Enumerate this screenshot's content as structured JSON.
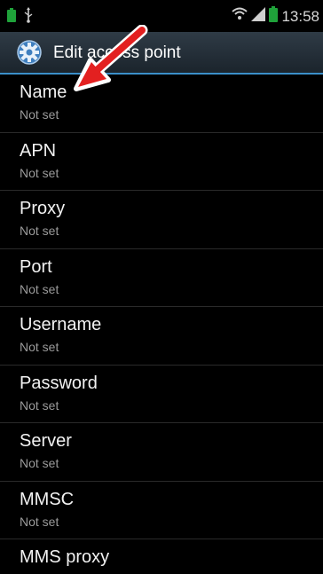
{
  "status_bar": {
    "time": "13:58",
    "icons": [
      "battery-small-icon",
      "usb-icon",
      "wifi-icon",
      "signal-icon",
      "battery-icon"
    ],
    "accent_color": "#1fa23a"
  },
  "action_bar": {
    "title": "Edit access point",
    "icon": "settings-gear-icon"
  },
  "list": {
    "items": [
      {
        "title": "Name",
        "summary": "Not set"
      },
      {
        "title": "APN",
        "summary": "Not set"
      },
      {
        "title": "Proxy",
        "summary": "Not set"
      },
      {
        "title": "Port",
        "summary": "Not set"
      },
      {
        "title": "Username",
        "summary": "Not set"
      },
      {
        "title": "Password",
        "summary": "Not set"
      },
      {
        "title": "Server",
        "summary": "Not set"
      },
      {
        "title": "MMSC",
        "summary": "Not set"
      },
      {
        "title": "MMS proxy",
        "summary": ""
      }
    ]
  },
  "annotation": {
    "icon": "red-arrow-icon",
    "color": "#e32020"
  }
}
